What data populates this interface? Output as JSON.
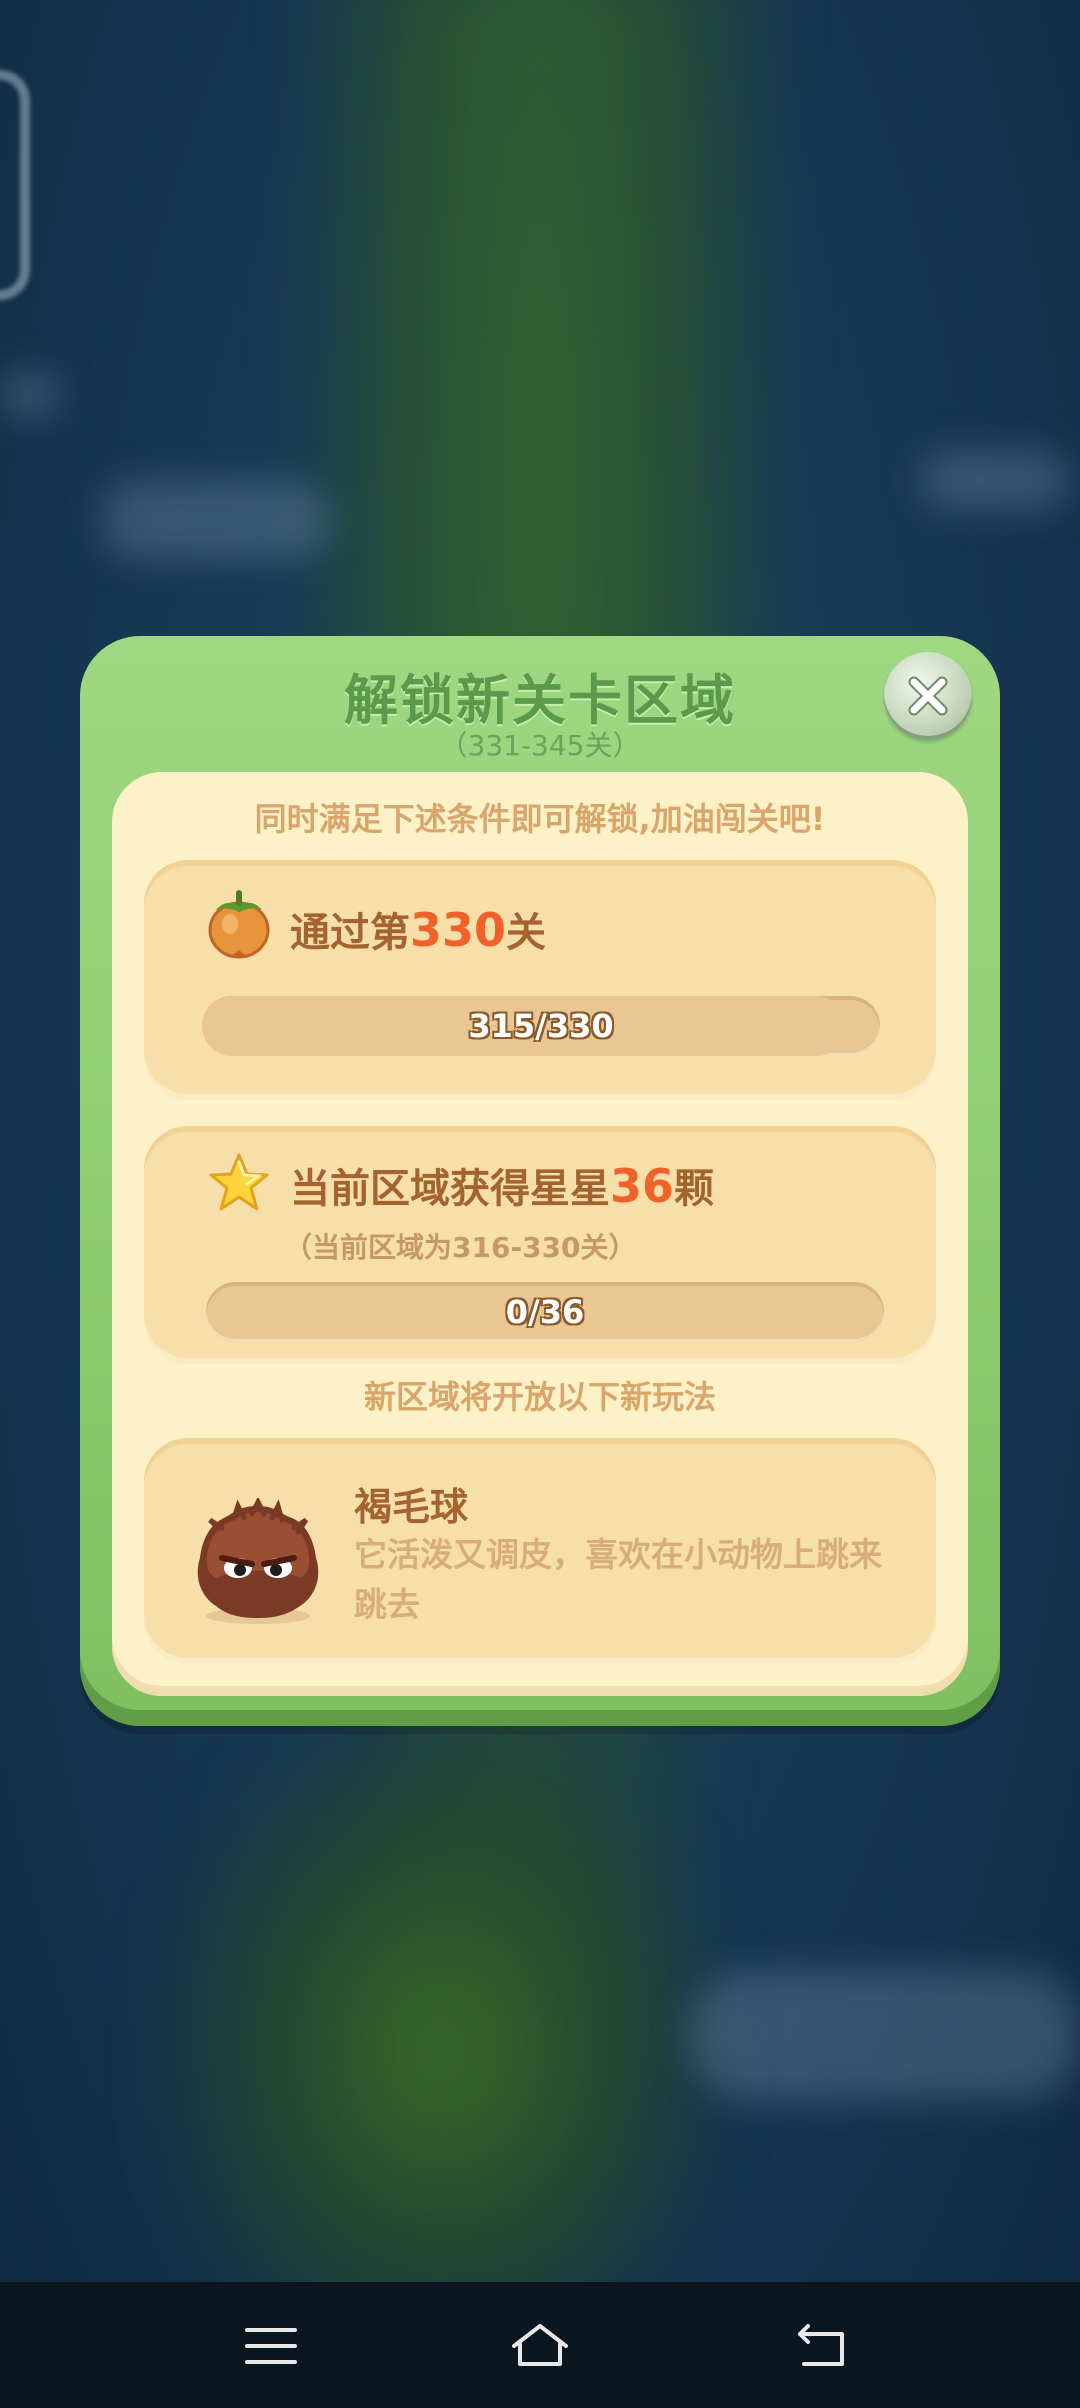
{
  "dialog": {
    "title": "解锁新关卡区域",
    "subtitle": "（331-345关）",
    "hint": "同时满足下述条件即可解锁,加油闯关吧!"
  },
  "conditions": [
    {
      "icon": "persimmon-icon",
      "text_prefix": "通过第",
      "highlight": "330",
      "text_suffix": "关",
      "progress_label": "315/330",
      "progress_value": 315,
      "progress_max": 330
    },
    {
      "icon": "star-icon",
      "text_prefix": "当前区域获得星星",
      "highlight": "36",
      "text_suffix": "颗",
      "note": "（当前区域为316-330关）",
      "progress_label": "0/36",
      "progress_value": 0,
      "progress_max": 36
    }
  ],
  "new_features_label": "新区域将开放以下新玩法",
  "feature": {
    "icon": "brown-furball-monster-icon",
    "name": "褐毛球",
    "description": "它活泼又调皮，喜欢在小动物上跳来跳去"
  },
  "colors": {
    "dialog_green": "#8ccb6d",
    "panel_cream": "#fdf1c8",
    "card_tan": "#f7dfaa",
    "highlight_orange": "#f0622a",
    "text_brown": "#a4642f"
  },
  "navbar": {
    "items": [
      "menu-icon",
      "home-icon",
      "back-icon"
    ]
  }
}
